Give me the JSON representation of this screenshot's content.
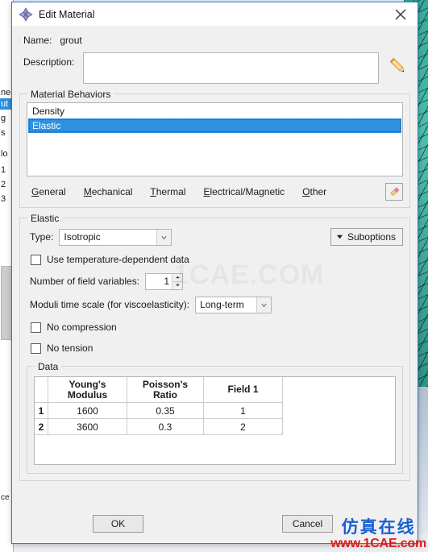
{
  "window": {
    "title": "Edit Material",
    "icon": "abaqus-diamond-icon",
    "close_icon": "close-icon",
    "accent_color": "#2a7ad4"
  },
  "form": {
    "name_label": "Name:",
    "name_value": "grout",
    "description_label": "Description:",
    "description_value": "",
    "description_edit_icon": "pencil-icon"
  },
  "material_behaviors": {
    "group_title": "Material Behaviors",
    "items": [
      {
        "label": "Density",
        "selected": false
      },
      {
        "label": "Elastic",
        "selected": true
      }
    ],
    "selection_color": "#2f8fe0",
    "menus": [
      {
        "label": "General",
        "mnemonic": "G"
      },
      {
        "label": "Mechanical",
        "mnemonic": "M"
      },
      {
        "label": "Thermal",
        "mnemonic": "T"
      },
      {
        "label": "Electrical/Magnetic",
        "mnemonic": "E"
      },
      {
        "label": "Other",
        "mnemonic": "O"
      }
    ],
    "delete_icon": "eraser-icon"
  },
  "elastic": {
    "group_title": "Elastic",
    "type_label": "Type:",
    "type_value": "Isotropic",
    "suboptions_label": "Suboptions",
    "suboptions_icon": "chevron-down-icon",
    "temp_dependent_label": "Use temperature-dependent data",
    "temp_dependent_checked": false,
    "field_variables_label": "Number of field variables:",
    "field_variables_value": "1",
    "moduli_label": "Moduli time scale (for viscoelasticity):",
    "moduli_value": "Long-term",
    "no_compression_label": "No compression",
    "no_compression_checked": false,
    "no_tension_label": "No tension",
    "no_tension_checked": false
  },
  "data": {
    "group_title": "Data",
    "columns": [
      "Young's\nModulus",
      "Poisson's\nRatio",
      "Field 1"
    ],
    "columns_lines": [
      [
        "Young's",
        "Modulus"
      ],
      [
        "Poisson's",
        "Ratio"
      ],
      [
        "Field 1",
        ""
      ]
    ],
    "rows": [
      {
        "index": "1",
        "youngs_modulus": "1600",
        "poissons_ratio": "0.35",
        "field_1": "1"
      },
      {
        "index": "2",
        "youngs_modulus": "3600",
        "poissons_ratio": "0.3",
        "field_1": "2"
      }
    ]
  },
  "footer": {
    "ok_label": "OK",
    "cancel_label": "Cancel"
  },
  "watermarks": {
    "faint_text": "1CAE.COM",
    "corner_cn": "仿真在线",
    "corner_url": "www.1CAE.com",
    "corner_cn_color": "#1a5fd0",
    "corner_url_color": "#d81e1e"
  },
  "background": {
    "left_fragments": [
      "ne",
      "ut",
      "g",
      "s",
      "lo",
      "1",
      "2",
      "3"
    ],
    "bottom_fragment": "ce"
  }
}
